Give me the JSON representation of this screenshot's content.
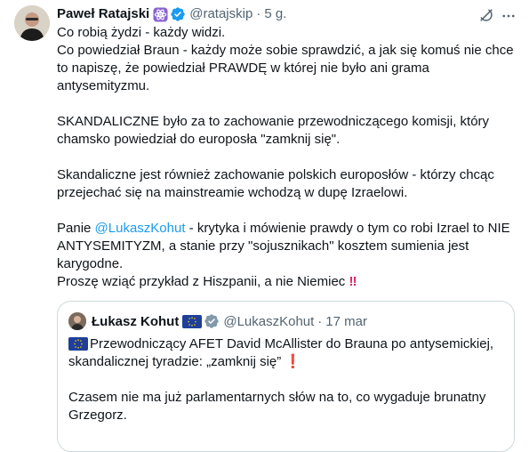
{
  "author": {
    "name": "Paweł Ratajski",
    "handle": "@ratajskip",
    "separator": "·",
    "time": "5 g."
  },
  "body": {
    "l1": "Co robią żydzi - każdy widzi.",
    "l2": "Co powiedział Braun - każdy może sobie sprawdzić, a jak się komuś nie chce to napiszę, że powiedział PRAWDĘ w której nie było ani grama antysemityzmu.",
    "l3": "SKANDALICZNE było za to zachowanie przewodniczącego komisji, który chamsko powiedział do europosła \"zamknij się\".",
    "l4": "Skandaliczne jest również zachowanie polskich europosłów - którzy chcąc przejechać się na mainstreamie wchodzą w dupę Izraelowi.",
    "l5_prefix": "Panie ",
    "l5_mention": "@LukaszKohut",
    "l5_rest": " - krytyka i mówienie prawdy o tym co robi Izrael to NIE ANTYSEMITYZM, a stanie przy \"sojusznikach\" kosztem sumienia jest karygodne.",
    "l6": "Proszę wziąć przykład z Hiszpanii, a nie Niemiec",
    "l6_emoji": "‼"
  },
  "quote": {
    "name": "Łukasz Kohut",
    "handle": "@LukaszKohut",
    "separator": "·",
    "time": "17 mar",
    "l1": "Przewodniczący AFET David McAllister do Brauna po antysemickiej, skandalicznej tyradzie: „zamknij się” ",
    "l1_emoji": "❗",
    "l2": "Czasem nie ma już parlamentarnych słów na to, co wygaduje brunatny Grzegorz."
  },
  "colors": {
    "link": "#1d9bf0",
    "verified": "#1d9bf0",
    "secondary_text": "#536471",
    "border": "#cfd9de"
  },
  "icons": [
    "avatar",
    "atom-emoji",
    "verified-badge-icon",
    "grok-icon",
    "more-icon",
    "eu-flag-icon"
  ]
}
